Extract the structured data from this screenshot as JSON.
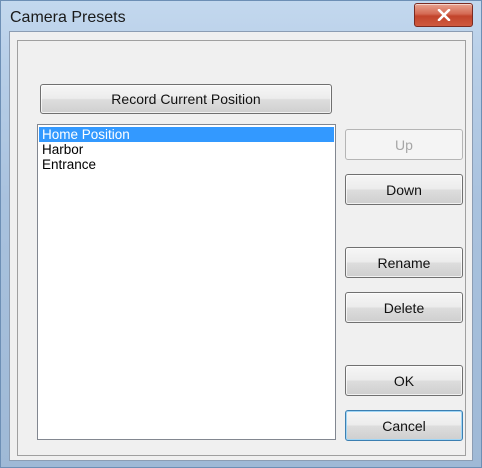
{
  "window": {
    "title": "Camera Presets",
    "close_icon": "close-x-icon"
  },
  "actions": {
    "record_label": "Record Current Position",
    "up_label": "Up",
    "down_label": "Down",
    "rename_label": "Rename",
    "delete_label": "Delete",
    "ok_label": "OK",
    "cancel_label": "Cancel"
  },
  "presets": {
    "selected": "Home Position",
    "items": [
      "Home Position",
      "Harbor",
      "Entrance"
    ]
  },
  "colors": {
    "selection": "#3399ff",
    "close_button": "#c2442b",
    "window_frame": "#b8cfe8"
  }
}
